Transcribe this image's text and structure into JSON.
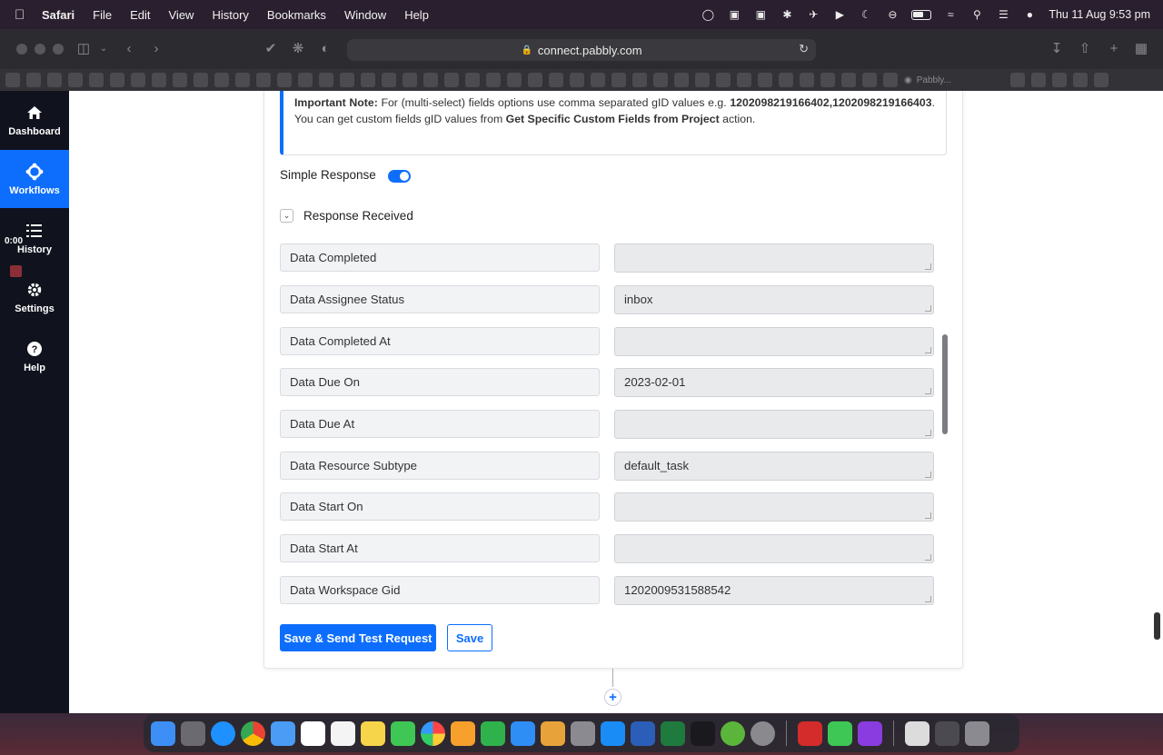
{
  "menubar": {
    "app": "Safari",
    "items": [
      "File",
      "Edit",
      "View",
      "History",
      "Bookmarks",
      "Window",
      "Help"
    ],
    "datetime": "Thu 11 Aug  9:53 pm"
  },
  "browser": {
    "url": "connect.pabbly.com",
    "tab_label": "Pabbly..."
  },
  "sidebar": {
    "items": [
      {
        "label": "Dashboard"
      },
      {
        "label": "Workflows"
      },
      {
        "label": "History"
      },
      {
        "label": "Settings"
      },
      {
        "label": "Help"
      }
    ],
    "timecode": "0:00"
  },
  "note": {
    "title": "Important Note:",
    "text1": " For (multi-select) fields options use comma separated gID values e.g. ",
    "example": "1202098219166402,1202098219166403",
    "text2": ". You can get custom fields gID values from ",
    "action": "Get Specific Custom Fields from Project",
    "text3": " action."
  },
  "simple_response": {
    "label": "Simple Response",
    "enabled": true
  },
  "response": {
    "section_label": "Response Received",
    "rows": [
      {
        "key": "Data Completed",
        "value": ""
      },
      {
        "key": "Data Assignee Status",
        "value": "inbox"
      },
      {
        "key": "Data Completed At",
        "value": ""
      },
      {
        "key": "Data Due On",
        "value": "2023-02-01"
      },
      {
        "key": "Data Due At",
        "value": ""
      },
      {
        "key": "Data Resource Subtype",
        "value": "default_task"
      },
      {
        "key": "Data Start On",
        "value": ""
      },
      {
        "key": "Data Start At",
        "value": ""
      },
      {
        "key": "Data Workspace Gid",
        "value": "1202009531588542"
      }
    ]
  },
  "actions": {
    "save_send": "Save & Send Test Request",
    "save": "Save"
  },
  "add_step": "+",
  "colors": {
    "accent": "#0d6efd",
    "sidebar_bg": "#10131e"
  }
}
